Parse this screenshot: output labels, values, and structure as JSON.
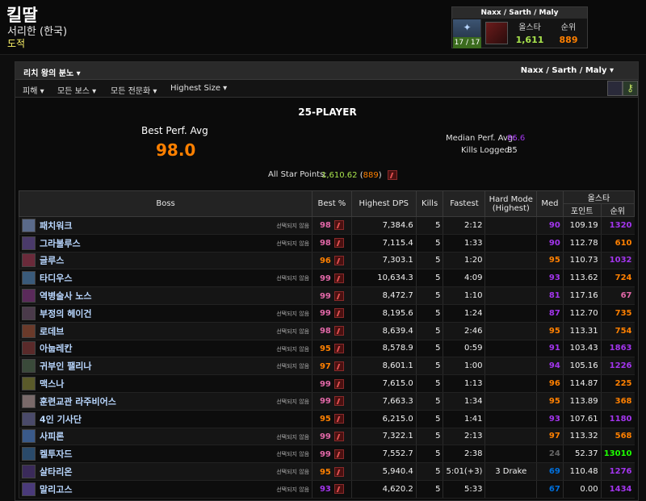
{
  "character": {
    "name": "킬딸",
    "server": "서리한 (한국)",
    "class": "도적"
  },
  "summary": {
    "title": "Naxx / Sarth / Maly",
    "count": "17 / 17",
    "allstar_label": "올스타",
    "allstar_value": "1,611",
    "rank_label": "순위",
    "rank_value": "889"
  },
  "filters": {
    "raid": "리치 왕의 분노",
    "zone_select": "Naxx / Sarth / Maly",
    "metric": "피해",
    "boss": "모든 보스",
    "spec": "모든 전문화",
    "size": "Highest Size"
  },
  "perf": {
    "title": "25-PLAYER",
    "best_label": "Best Perf. Avg",
    "best_value": "98.0",
    "median_label": "Median Perf. Avg:",
    "median_value": "86.6",
    "kills_label": "Kills Logged:",
    "kills_value": "85",
    "asp_label": "All Star Points:",
    "asp_value": "1,610.62",
    "asp_rank": "889"
  },
  "table": {
    "headers": {
      "boss": "Boss",
      "best": "Best %",
      "dps": "Highest DPS",
      "kills": "Kills",
      "fastest": "Fastest",
      "hard_mode": "Hard Mode",
      "hard_mode2": "(Highest)",
      "med": "Med",
      "allstar": "올스타",
      "points": "포인트",
      "rank": "순위"
    },
    "unselected_label": "선택되지 않음",
    "rows": [
      {
        "boss": "패치워크",
        "unsel": true,
        "best": "98",
        "dps": "7,384.6",
        "kills": "5",
        "fastest": "2:12",
        "hm": "",
        "med": "90",
        "points": "109.19",
        "rank": "1320",
        "bc": "#e268a8",
        "mc": "#a335ee",
        "rc": "#a335ee",
        "ic": "#5a6a8a"
      },
      {
        "boss": "그라불루스",
        "unsel": true,
        "best": "98",
        "dps": "7,115.4",
        "kills": "5",
        "fastest": "1:33",
        "hm": "",
        "med": "90",
        "points": "112.78",
        "rank": "610",
        "bc": "#e268a8",
        "mc": "#a335ee",
        "rc": "#ff8000",
        "ic": "#4a3a6a"
      },
      {
        "boss": "글루스",
        "unsel": false,
        "best": "96",
        "dps": "7,303.1",
        "kills": "5",
        "fastest": "1:20",
        "hm": "",
        "med": "95",
        "points": "110.73",
        "rank": "1032",
        "bc": "#ff8000",
        "mc": "#ff8000",
        "rc": "#a335ee",
        "ic": "#6a2a3a"
      },
      {
        "boss": "타디우스",
        "unsel": true,
        "best": "99",
        "dps": "10,634.3",
        "kills": "5",
        "fastest": "4:09",
        "hm": "",
        "med": "93",
        "points": "113.62",
        "rank": "724",
        "bc": "#e268a8",
        "mc": "#a335ee",
        "rc": "#ff8000",
        "ic": "#3a5a7a"
      },
      {
        "boss": "역병술사 노스",
        "unsel": false,
        "best": "99",
        "dps": "8,472.7",
        "kills": "5",
        "fastest": "1:10",
        "hm": "",
        "med": "81",
        "points": "117.16",
        "rank": "67",
        "bc": "#e268a8",
        "mc": "#a335ee",
        "rc": "#e268a8",
        "ic": "#5a2a5a"
      },
      {
        "boss": "부정의 헤이건",
        "unsel": true,
        "best": "99",
        "dps": "8,195.6",
        "kills": "5",
        "fastest": "1:24",
        "hm": "",
        "med": "87",
        "points": "112.70",
        "rank": "735",
        "bc": "#e268a8",
        "mc": "#a335ee",
        "rc": "#ff8000",
        "ic": "#4a3a4a"
      },
      {
        "boss": "로데브",
        "unsel": true,
        "best": "98",
        "dps": "8,639.4",
        "kills": "5",
        "fastest": "2:46",
        "hm": "",
        "med": "95",
        "points": "113.31",
        "rank": "754",
        "bc": "#e268a8",
        "mc": "#ff8000",
        "rc": "#ff8000",
        "ic": "#6a3a2a"
      },
      {
        "boss": "아눕레칸",
        "unsel": true,
        "best": "95",
        "dps": "8,578.9",
        "kills": "5",
        "fastest": "0:59",
        "hm": "",
        "med": "91",
        "points": "103.43",
        "rank": "1863",
        "bc": "#ff8000",
        "mc": "#a335ee",
        "rc": "#a335ee",
        "ic": "#5a2a2a"
      },
      {
        "boss": "귀부인 팰리나",
        "unsel": true,
        "best": "97",
        "dps": "8,601.1",
        "kills": "5",
        "fastest": "1:00",
        "hm": "",
        "med": "94",
        "points": "105.16",
        "rank": "1226",
        "bc": "#ff8000",
        "mc": "#a335ee",
        "rc": "#a335ee",
        "ic": "#3a4a3a"
      },
      {
        "boss": "맥스나",
        "unsel": false,
        "best": "99",
        "dps": "7,615.0",
        "kills": "5",
        "fastest": "1:13",
        "hm": "",
        "med": "96",
        "points": "114.87",
        "rank": "225",
        "bc": "#e268a8",
        "mc": "#ff8000",
        "rc": "#ff8000",
        "ic": "#5a5a2a"
      },
      {
        "boss": "훈련교관 라주비어스",
        "unsel": true,
        "best": "99",
        "dps": "7,663.3",
        "kills": "5",
        "fastest": "1:34",
        "hm": "",
        "med": "95",
        "points": "113.89",
        "rank": "368",
        "bc": "#e268a8",
        "mc": "#ff8000",
        "rc": "#ff8000",
        "ic": "#7a6a6a"
      },
      {
        "boss": "4인 기사단",
        "unsel": false,
        "best": "95",
        "dps": "6,215.0",
        "kills": "5",
        "fastest": "1:41",
        "hm": "",
        "med": "93",
        "points": "107.61",
        "rank": "1180",
        "bc": "#ff8000",
        "mc": "#a335ee",
        "rc": "#a335ee",
        "ic": "#4a4a6a"
      },
      {
        "boss": "사피론",
        "unsel": true,
        "best": "99",
        "dps": "7,322.1",
        "kills": "5",
        "fastest": "2:13",
        "hm": "",
        "med": "97",
        "points": "113.32",
        "rank": "568",
        "bc": "#e268a8",
        "mc": "#ff8000",
        "rc": "#ff8000",
        "ic": "#3a5a8a"
      },
      {
        "boss": "켈투자드",
        "unsel": true,
        "best": "99",
        "dps": "7,552.7",
        "kills": "5",
        "fastest": "2:38",
        "hm": "",
        "med": "24",
        "points": "52.37",
        "rank": "13010",
        "bc": "#e268a8",
        "mc": "#666666",
        "rc": "#1eff00",
        "ic": "#2a4a6a"
      },
      {
        "boss": "살타리온",
        "unsel": true,
        "best": "95",
        "dps": "5,940.4",
        "kills": "5",
        "fastest": "5:01(+3)",
        "hm": "3 Drake",
        "med": "69",
        "points": "110.48",
        "rank": "1276",
        "bc": "#ff8000",
        "mc": "#0070dd",
        "rc": "#a335ee",
        "ic": "#3a2a5a"
      },
      {
        "boss": "말리고스",
        "unsel": true,
        "best": "93",
        "dps": "4,620.2",
        "kills": "5",
        "fastest": "5:33",
        "hm": "",
        "med": "67",
        "points": "0.00",
        "rank": "1434",
        "bc": "#a335ee",
        "mc": "#0070dd",
        "rc": "#a335ee",
        "ic": "#4a3a7a"
      }
    ]
  },
  "colors": {
    "legendary": "#ff8000",
    "astounding": "#e268a8",
    "epic": "#a335ee",
    "rare": "#0070dd",
    "uncommon": "#1eff00",
    "common": "#666666",
    "class_rogue": "#fff569",
    "boss_name": "#b9d7ff"
  }
}
